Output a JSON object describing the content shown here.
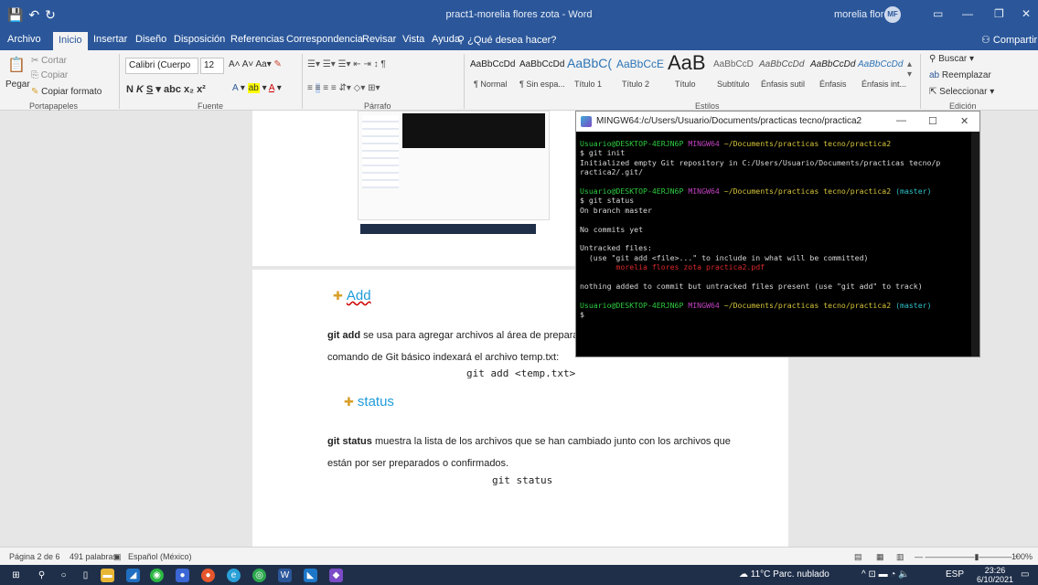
{
  "word": {
    "title": "pract1-morelia flores zota  -  Word",
    "user_name": "morelia flores",
    "user_initials": "MF"
  },
  "tabs": [
    {
      "label": "Archivo"
    },
    {
      "label": "Inicio"
    },
    {
      "label": "Insertar"
    },
    {
      "label": "Diseño"
    },
    {
      "label": "Disposición"
    },
    {
      "label": "Referencias"
    },
    {
      "label": "Correspondencia"
    },
    {
      "label": "Revisar"
    },
    {
      "label": "Vista"
    },
    {
      "label": "Ayuda"
    }
  ],
  "tell_me": "¿Qué desea hacer?",
  "share_label": "Compartir",
  "ribbon": {
    "clipboard": {
      "cut": "Cortar",
      "copy": "Copiar",
      "paste": "Pegar",
      "format_painter": "Copiar formato",
      "label": "Portapapeles"
    },
    "font": {
      "name": "Calibri (Cuerpo",
      "size": "12",
      "label": "Fuente"
    },
    "paragraph": {
      "label": "Párrafo"
    },
    "styles": {
      "label": "Estilos",
      "items": [
        {
          "preview": "AaBbCcDd",
          "name": "¶ Normal"
        },
        {
          "preview": "AaBbCcDd",
          "name": "¶ Sin espa..."
        },
        {
          "preview": "AaBbC(",
          "name": "Título 1"
        },
        {
          "preview": "AaBbCcE",
          "name": "Título 2"
        },
        {
          "preview": "AaB",
          "name": "Título"
        },
        {
          "preview": "AaBbCcD",
          "name": "Subtítulo"
        },
        {
          "preview": "AaBbCcDd",
          "name": "Énfasis sutil"
        },
        {
          "preview": "AaBbCcDd",
          "name": "Énfasis"
        },
        {
          "preview": "AaBbCcDd",
          "name": "Énfasis int..."
        }
      ]
    },
    "editing": {
      "find": "Buscar",
      "replace": "Reemplazar",
      "select": "Seleccionar",
      "label": "Edición"
    }
  },
  "document": {
    "add_heading": "Add",
    "add_para_1_bold": "git add",
    "add_para_1": " se usa para agregar archivos al área de preparación",
    "add_para_2": "comando de Git básico indexará el archivo temp.txt:",
    "add_code": "git add <temp.txt>",
    "status_heading": "status",
    "status_para_1_bold": "git status",
    "status_para_1": " muestra la lista de los archivos que se han cambiado junto con los archivos que",
    "status_para_2": "están por ser preparados o confirmados.",
    "status_code": "git status"
  },
  "terminal": {
    "title": "MINGW64:/c/Users/Usuario/Documents/practicas tecno/practica2",
    "prompt_user": "Usuario@DESKTOP-4ERJN6P",
    "prompt_env": "MINGW64",
    "path": "~/Documents/practicas tecno/practica2",
    "branch": "(master)",
    "cmd1": "$ git init",
    "out1a": "Initialized empty Git repository in C:/Users/Usuario/Documents/practicas tecno/p",
    "out1b": "ractica2/.git/",
    "cmd2": "$ git status",
    "out2a": "On branch master",
    "out2b": "No commits yet",
    "out2c": "Untracked files:",
    "out2d": "  (use \"git add <file>...\" to include in what will be committed)",
    "out2e": "        morelia flores zota practica2.pdf",
    "out2f": "nothing added to commit but untracked files present (use \"git add\" to track)",
    "cmd3": "$"
  },
  "status_bar": {
    "page": "Página 2 de 6",
    "words": "491 palabras",
    "language": "Español (México)",
    "zoom": "100%"
  },
  "taskbar": {
    "weather": "11°C  Parc. nublado",
    "lang": "ESP",
    "time": "23:26",
    "date": "6/10/2021"
  },
  "colors": {
    "word_blue": "#2b579a",
    "heading_blue": "#1f9bd8",
    "term_green": "#2ecc40",
    "term_magenta": "#c142c1",
    "term_yellow": "#d6c43a",
    "term_cyan": "#2ec2c9",
    "term_red": "#d9292b"
  }
}
